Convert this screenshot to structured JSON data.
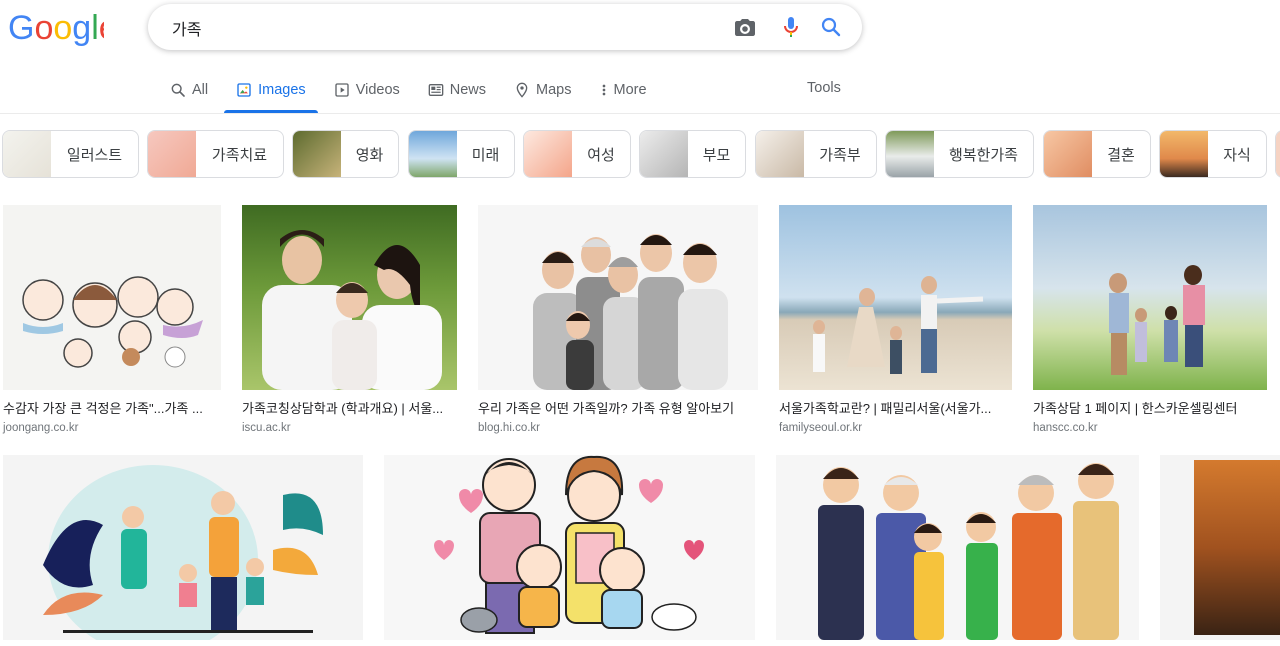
{
  "search": {
    "query": "가족"
  },
  "tabs": [
    {
      "label": "All",
      "icon": "search-icon"
    },
    {
      "label": "Images",
      "icon": "image-icon"
    },
    {
      "label": "Videos",
      "icon": "video-icon"
    },
    {
      "label": "News",
      "icon": "news-icon"
    },
    {
      "label": "Maps",
      "icon": "map-pin-icon"
    },
    {
      "label": "More",
      "icon": "more-vert-icon"
    }
  ],
  "tools_label": "Tools",
  "chips": [
    "일러스트",
    "가족치료",
    "영화",
    "미래",
    "여성",
    "부모",
    "가족부",
    "행복한가족",
    "결혼",
    "자식"
  ],
  "results_row1": [
    {
      "caption": "수감자 가장 큰 걱정은 가족\"...가족 ...",
      "source": "joongang.co.kr"
    },
    {
      "caption": "가족코칭상담학과 (학과개요) | 서울...",
      "source": "iscu.ac.kr"
    },
    {
      "caption": "우리 가족은 어떤 가족일까? 가족 유형 알아보기",
      "source": "blog.hi.co.kr"
    },
    {
      "caption": "서울가족학교란? | 패밀리서울(서울가...",
      "source": "familyseoul.or.kr"
    },
    {
      "caption": "가족상담 1 페이지 | 한스카운셀링센터",
      "source": "hanscc.co.kr"
    }
  ],
  "colors": {
    "accent": "#1a73e8",
    "google_blue": "#4285f4",
    "google_red": "#ea4335",
    "google_yellow": "#fbbc05",
    "google_green": "#34a853"
  }
}
